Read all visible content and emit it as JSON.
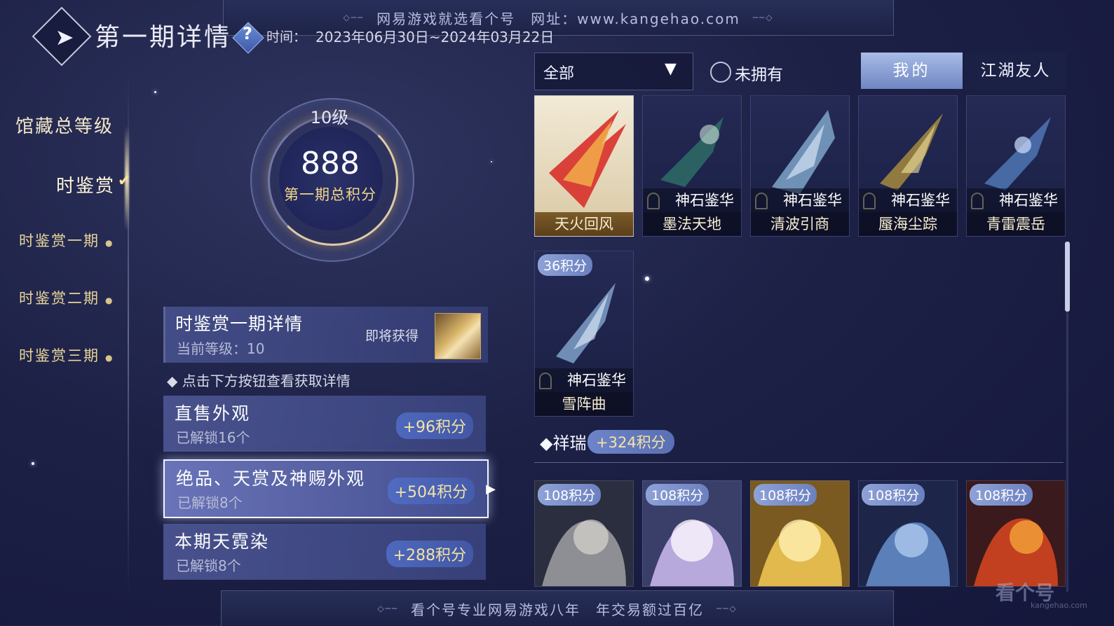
{
  "banner_top": {
    "text": "网易游戏就选看个号　网址：www.kangehao.com"
  },
  "banner_bottom": {
    "text": "看个号专业网易游戏八年　年交易额过百亿"
  },
  "header": {
    "title": "第一期详情",
    "time_label": "时间：",
    "time_value": "2023年06月30日~2024年03月22日"
  },
  "sidebar": {
    "main_label": "馆藏总等级",
    "active_label": "时鉴赏",
    "items": [
      {
        "label": "时鉴赏一期"
      },
      {
        "label": "时鉴赏二期"
      },
      {
        "label": "时鉴赏三期"
      }
    ]
  },
  "score": {
    "level": "10级",
    "points": "888",
    "label": "第一期总积分",
    "progress": 0.75
  },
  "detail": {
    "title": "时鉴赏一期详情",
    "current_level": "当前等级：10",
    "soon_label": "即将获得"
  },
  "hint": "点击下方按钮查看获取详情",
  "options": [
    {
      "title": "直售外观",
      "sub": "已解锁16个",
      "badge": "+96积分"
    },
    {
      "title": "绝品、天赏及神赐外观",
      "sub": "已解锁8个",
      "badge": "+504积分"
    },
    {
      "title": "本期天霓染",
      "sub": "已解锁8个",
      "badge": "+288积分"
    }
  ],
  "filters": {
    "select_value": "全部",
    "radio_label": "未拥有",
    "tab_mine": "我的",
    "tab_friends": "江湖友人"
  },
  "items_row1": [
    {
      "name": "天火回风",
      "tag": "",
      "colors": [
        "#f7f1e2",
        "#d8302a",
        "#f3b44a"
      ]
    },
    {
      "name": "墨法天地",
      "tag": "神石鉴华",
      "colors": [
        "#1d2440",
        "#2e6c66",
        "#cfe3da"
      ]
    },
    {
      "name": "清波引商",
      "tag": "神石鉴华",
      "colors": [
        "#1c2442",
        "#7ea5c8",
        "#e6f0ff"
      ]
    },
    {
      "name": "蜃海尘踪",
      "tag": "神石鉴华",
      "colors": [
        "#1d2440",
        "#a48a3e",
        "#f3e2a0"
      ]
    },
    {
      "name": "青雷震岳",
      "tag": "神石鉴华",
      "colors": [
        "#1b2242",
        "#4f76b4",
        "#cfe0ff"
      ]
    }
  ],
  "items_row2": [
    {
      "name": "雪阵曲",
      "tag": "神石鉴华",
      "points": "36积分",
      "colors": [
        "#1c2344",
        "#7fa0c8",
        "#e8f3ff"
      ]
    }
  ],
  "section": {
    "title": "祥瑞",
    "badge": "+324积分"
  },
  "items_row3": [
    {
      "points": "108积分",
      "colors": [
        "#2a2e3e",
        "#8d8f94",
        "#d8d6d0"
      ]
    },
    {
      "points": "108积分",
      "colors": [
        "#3a3f6a",
        "#b8a9dc",
        "#fbf6ff"
      ]
    },
    {
      "points": "108积分",
      "colors": [
        "#7a5a20",
        "#e1b94c",
        "#fff0b3"
      ]
    },
    {
      "points": "108积分",
      "colors": [
        "#1d2548",
        "#5a7fb9",
        "#b8d3f5"
      ]
    },
    {
      "points": "108积分",
      "colors": [
        "#3a1a1c",
        "#c2401f",
        "#f5a23a"
      ]
    }
  ],
  "watermark": {
    "main": "看个号",
    "sub": "kangehao.com"
  }
}
